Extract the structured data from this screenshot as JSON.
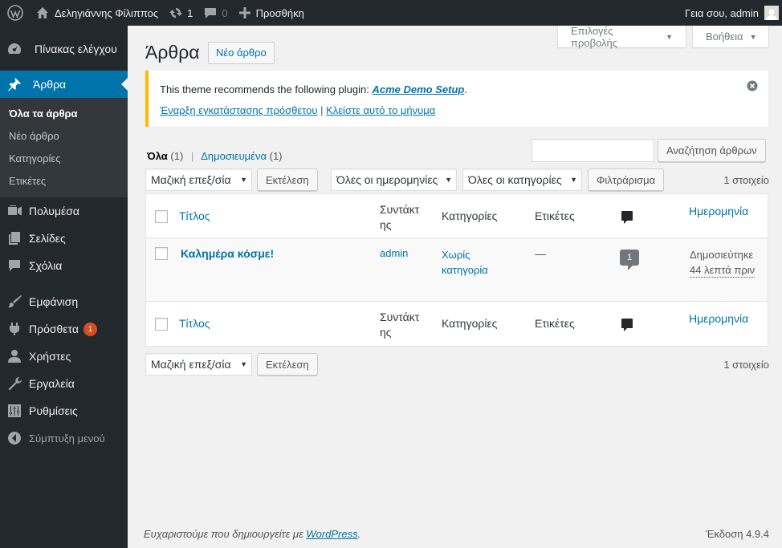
{
  "adminbar": {
    "site_name": "Δεληγιάννης Φίλιππος",
    "updates_count": "1",
    "comments_count": "0",
    "new_label": "Προσθήκη",
    "greeting": "Γεια σου, admin"
  },
  "sidebar": {
    "dashboard": "Πίνακας ελέγχου",
    "posts": "Άρθρα",
    "sub": [
      "Όλα τα άρθρα",
      "Νέο άρθρο",
      "Κατηγορίες",
      "Ετικέτες"
    ],
    "media": "Πολυμέσα",
    "pages": "Σελίδες",
    "comments": "Σχόλια",
    "appearance": "Εμφάνιση",
    "plugins": "Πρόσθετα",
    "plugins_badge": "1",
    "users": "Χρήστες",
    "tools": "Εργαλεία",
    "settings": "Ρυθμίσεις",
    "collapse": "Σύμπτυξη μενού"
  },
  "screen_options": "Επιλογές προβολής",
  "help": "Βοήθεια",
  "page_title": "Άρθρα",
  "new_post_button": "Νέο άρθρο",
  "notice": {
    "text": "This theme recommends the following plugin: ",
    "plugin_link": "Acme Demo Setup",
    "period": ".",
    "install_link": "Έναρξη εγκατάστασης πρόσθετου",
    "separator": "|",
    "dismiss_link": "Κλείστε αυτό το μήνυμα"
  },
  "views": {
    "all_label": "Όλα",
    "all_count": "(1)",
    "separator": "|",
    "published_label": "Δημοσιευμένα",
    "published_count": "(1)"
  },
  "search": {
    "value": "",
    "button": "Αναζήτηση άρθρων"
  },
  "bulk_actions": "Μαζική επεξ/σία",
  "apply": "Εκτέλεση",
  "dates_filter": "Όλες οι ημερομηνίες",
  "category_filter": "Όλες οι κατηγορίες",
  "filter_button": "Φιλτράρισμα",
  "items_count": "1 στοιχείο",
  "columns": {
    "title": "Τίτλος",
    "author_line1": "Συντάκτ",
    "author_line2": "ης",
    "categories": "Κατηγορίες",
    "tags": "Ετικέτες",
    "date": "Ημερομηνία"
  },
  "post": {
    "title": "Καλημέρα κόσμε!",
    "author": "admin",
    "category_line1": "Χωρίς",
    "category_line2": "κατηγορία",
    "tags": "—",
    "comments": "1",
    "status": "Δημοσιεύτηκε",
    "time": "44 λεπτά πριν"
  },
  "footer": {
    "thanks_prefix": "Ευχαριστούμε που δημιουργείτε με ",
    "wp_link": "WordPress",
    "thanks_suffix": ".",
    "version": "Έκδοση 4.9.4"
  },
  "colors": {
    "accent": "#0073aa",
    "sidebar": "#23282d",
    "notice_border": "#ffb900",
    "badge": "#d54e21"
  }
}
